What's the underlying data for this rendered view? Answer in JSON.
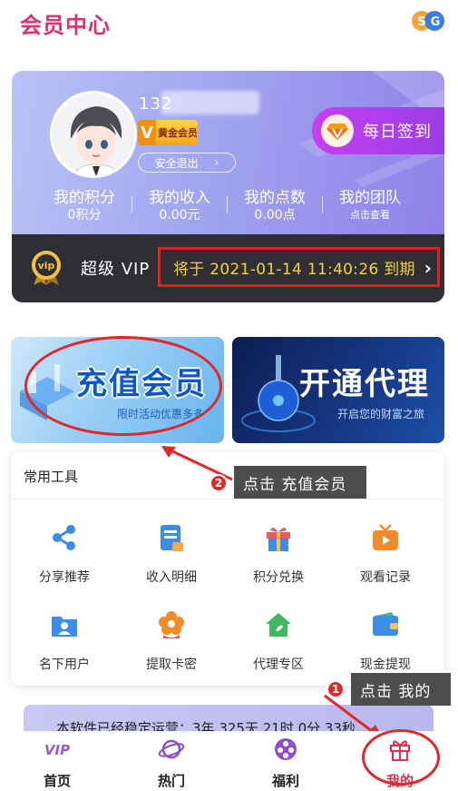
{
  "header": {
    "title": "会员中心",
    "logo_icon": "sg-logo-icon"
  },
  "member": {
    "phone": "132",
    "badge_letter": "V",
    "badge_text": "黄金会员",
    "logout_label": "安全退出",
    "checkin_label": "每日签到",
    "stats": [
      {
        "label": "我的积分",
        "value": "0积分"
      },
      {
        "label": "我的收入",
        "value": "0.00元"
      },
      {
        "label": "我的点数",
        "value": "0.00点"
      },
      {
        "label": "我的团队",
        "value": "点击查看"
      }
    ],
    "vip_coin_text": "vip",
    "vip_level": "超级 VIP",
    "expire_text": "将于 2021-01-14 11:40:26 到期"
  },
  "banners": {
    "left": {
      "title": "充值会员",
      "subtitle": "限时活动优惠多多"
    },
    "right": {
      "title": "开通代理",
      "subtitle": "开启您的财富之旅"
    }
  },
  "tools": {
    "title": "常用工具",
    "items": [
      {
        "label": "分享推荐",
        "icon": "share-icon"
      },
      {
        "label": "收入明细",
        "icon": "bill-icon"
      },
      {
        "label": "积分兑换",
        "icon": "gift-icon"
      },
      {
        "label": "观看记录",
        "icon": "play-tv-icon"
      },
      {
        "label": "名下用户",
        "icon": "user-folder-icon"
      },
      {
        "label": "提取卡密",
        "icon": "flower-icon"
      },
      {
        "label": "代理专区",
        "icon": "home-icon"
      },
      {
        "label": "现金提现",
        "icon": "wallet-icon"
      }
    ]
  },
  "callouts": {
    "step1_number": "1",
    "step1_text": "点击  我的",
    "step2_number": "2",
    "step2_text": "点击  充值会员"
  },
  "notice": {
    "text": "本软件已经稳定运营：3年 325天 21时 0分 33秒"
  },
  "nav": {
    "items": [
      {
        "label": "首页",
        "icon": "vip-icon"
      },
      {
        "label": "热门",
        "icon": "planet-icon"
      },
      {
        "label": "福利",
        "icon": "film-reel-icon"
      },
      {
        "label": "我的",
        "icon": "gift-box-icon"
      }
    ]
  },
  "colors": {
    "accent": "#e0306a",
    "highlight": "#e02828",
    "expire_text": "#f4d33a"
  }
}
